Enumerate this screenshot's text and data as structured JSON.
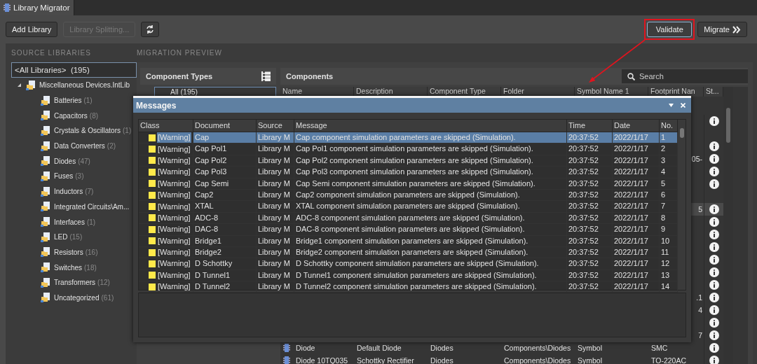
{
  "tab": {
    "title": "Library Migrator",
    "selected": true
  },
  "toolbar": {
    "buttons": [
      {
        "label": "Add Library",
        "disabled": false
      },
      {
        "label": "Library Splitting...",
        "disabled": true
      }
    ],
    "validate": {
      "label": "Validate",
      "focused": true
    },
    "migrate": {
      "label": "Migrate"
    }
  },
  "source_libraries": {
    "heading": "SOURCE LIBRARIES",
    "all": {
      "label": "<All Libraries>",
      "count": "(195)",
      "selected": true
    },
    "tree": [
      {
        "label": "Miscellaneous Devices.IntLib",
        "expanded": true,
        "children": [
          {
            "label": "Batteries",
            "count": "(1)"
          },
          {
            "label": "Capacitors",
            "count": "(8)"
          },
          {
            "label": "Crystals & Oscillators",
            "count": "(1)"
          },
          {
            "label": "Data Converters",
            "count": "(2)"
          },
          {
            "label": "Diodes",
            "count": "(47)"
          },
          {
            "label": "Fuses",
            "count": "(3)"
          },
          {
            "label": "Inductors",
            "count": "(7)"
          },
          {
            "label": "Integrated Circuits\\Am..."
          },
          {
            "label": "Interfaces",
            "count": "(1)"
          },
          {
            "label": "LED",
            "count": "(15)"
          },
          {
            "label": "Resistors",
            "count": "(16)"
          },
          {
            "label": "Switches",
            "count": "(18)"
          },
          {
            "label": "Transformers",
            "count": "(12)"
          },
          {
            "label": "Uncategorized",
            "count": "(61)"
          }
        ]
      }
    ]
  },
  "migration_preview": {
    "heading": "MIGRATION PREVIEW",
    "component_types": {
      "title": "Component Types",
      "items": [
        {
          "label": "All (195)",
          "selected": true
        }
      ]
    },
    "components": {
      "title": "Components",
      "search": {
        "placeholder": "Search"
      },
      "columns": [
        "Name",
        "Description",
        "Component Type",
        "Folder",
        "Symbol Name 1",
        "Footprint Nan",
        "St..."
      ],
      "rows": [
        {
          "info": true,
          "selected": false
        },
        {
          "info": false,
          "selected": false
        },
        {
          "info": true,
          "selected": false
        },
        {
          "footprint": "05-",
          "info": true,
          "selected": false
        },
        {
          "info": true,
          "selected": false
        },
        {
          "info": true,
          "selected": false
        },
        {
          "info": false,
          "selected": false
        },
        {
          "footprint": "5",
          "info": true,
          "selected": true
        },
        {
          "info": true,
          "selected": false
        },
        {
          "info": true,
          "selected": false
        },
        {
          "info": true,
          "selected": false
        },
        {
          "info": true,
          "selected": false
        },
        {
          "info": true,
          "selected": false
        },
        {
          "info": true,
          "selected": false
        },
        {
          "footprint": ".1",
          "info": true,
          "selected": false
        },
        {
          "footprint": "4",
          "info": true,
          "selected": false
        },
        {
          "info": true,
          "selected": false
        },
        {
          "footprint": "7",
          "info": true,
          "selected": false
        },
        {
          "name": "Diode",
          "description": "Default Diode",
          "type": "Diodes",
          "folder": "Components\\Diodes",
          "symbol": "Symbol",
          "footprint": "SMC",
          "info": true,
          "selected": false
        },
        {
          "name": "Diode 10TQ035",
          "description": "Schottky Rectifier",
          "type": "Diodes",
          "folder": "Components\\Diodes",
          "symbol": "Symbol",
          "footprint": "TO-220AC",
          "info": true,
          "selected": false
        }
      ]
    }
  },
  "messages": {
    "title": "Messages",
    "columns": [
      "Class",
      "Document",
      "Source",
      "Message",
      "Time",
      "Date",
      "No."
    ],
    "rows": [
      {
        "class": "[Warning]",
        "document": "Cap",
        "source": "Library M",
        "message": "Cap component simulation parameters are skipped (Simulation).",
        "time": "20:37:52",
        "date": "2022/1/17",
        "no": "1",
        "selected": true
      },
      {
        "class": "[Warning]",
        "document": "Cap Pol1",
        "source": "Library M",
        "message": "Cap Pol1 component simulation parameters are skipped (Simulation).",
        "time": "20:37:52",
        "date": "2022/1/17",
        "no": "2",
        "selected": false
      },
      {
        "class": "[Warning]",
        "document": "Cap Pol2",
        "source": "Library M",
        "message": "Cap Pol2 component simulation parameters are skipped (Simulation).",
        "time": "20:37:52",
        "date": "2022/1/17",
        "no": "3",
        "selected": false
      },
      {
        "class": "[Warning]",
        "document": "Cap Pol3",
        "source": "Library M",
        "message": "Cap Pol3 component simulation parameters are skipped (Simulation).",
        "time": "20:37:52",
        "date": "2022/1/17",
        "no": "4",
        "selected": false
      },
      {
        "class": "[Warning]",
        "document": "Cap Semi",
        "source": "Library M",
        "message": "Cap Semi component simulation parameters are skipped (Simulation).",
        "time": "20:37:52",
        "date": "2022/1/17",
        "no": "5",
        "selected": false
      },
      {
        "class": "[Warning]",
        "document": "Cap2",
        "source": "Library M",
        "message": "Cap2 component simulation parameters are skipped (Simulation).",
        "time": "20:37:52",
        "date": "2022/1/17",
        "no": "6",
        "selected": false
      },
      {
        "class": "[Warning]",
        "document": "XTAL",
        "source": "Library M",
        "message": "XTAL component simulation parameters are skipped (Simulation).",
        "time": "20:37:52",
        "date": "2022/1/17",
        "no": "7",
        "selected": false
      },
      {
        "class": "[Warning]",
        "document": "ADC-8",
        "source": "Library M",
        "message": "ADC-8 component simulation parameters are skipped (Simulation).",
        "time": "20:37:52",
        "date": "2022/1/17",
        "no": "8",
        "selected": false
      },
      {
        "class": "[Warning]",
        "document": "DAC-8",
        "source": "Library M",
        "message": "DAC-8 component simulation parameters are skipped (Simulation).",
        "time": "20:37:52",
        "date": "2022/1/17",
        "no": "9",
        "selected": false
      },
      {
        "class": "[Warning]",
        "document": "Bridge1",
        "source": "Library M",
        "message": "Bridge1 component simulation parameters are skipped (Simulation).",
        "time": "20:37:52",
        "date": "2022/1/17",
        "no": "10",
        "selected": false
      },
      {
        "class": "[Warning]",
        "document": "Bridge2",
        "source": "Library M",
        "message": "Bridge2 component simulation parameters are skipped (Simulation).",
        "time": "20:37:52",
        "date": "2022/1/17",
        "no": "11",
        "selected": false
      },
      {
        "class": "[Warning]",
        "document": "D Schottky",
        "source": "Library M",
        "message": "D Schottky component simulation parameters are skipped (Simulation).",
        "time": "20:37:52",
        "date": "2022/1/17",
        "no": "12",
        "selected": false
      },
      {
        "class": "[Warning]",
        "document": "D Tunnel1",
        "source": "Library M",
        "message": "D Tunnel1 component simulation parameters are skipped (Simulation).",
        "time": "20:37:52",
        "date": "2022/1/17",
        "no": "13",
        "selected": false
      },
      {
        "class": "[Warning]",
        "document": "D Tunnel2",
        "source": "Library M",
        "message": "D Tunnel2 component simulation parameters are skipped (Simulation).",
        "time": "20:37:52",
        "date": "2022/1/17",
        "no": "14",
        "selected": false
      }
    ]
  }
}
